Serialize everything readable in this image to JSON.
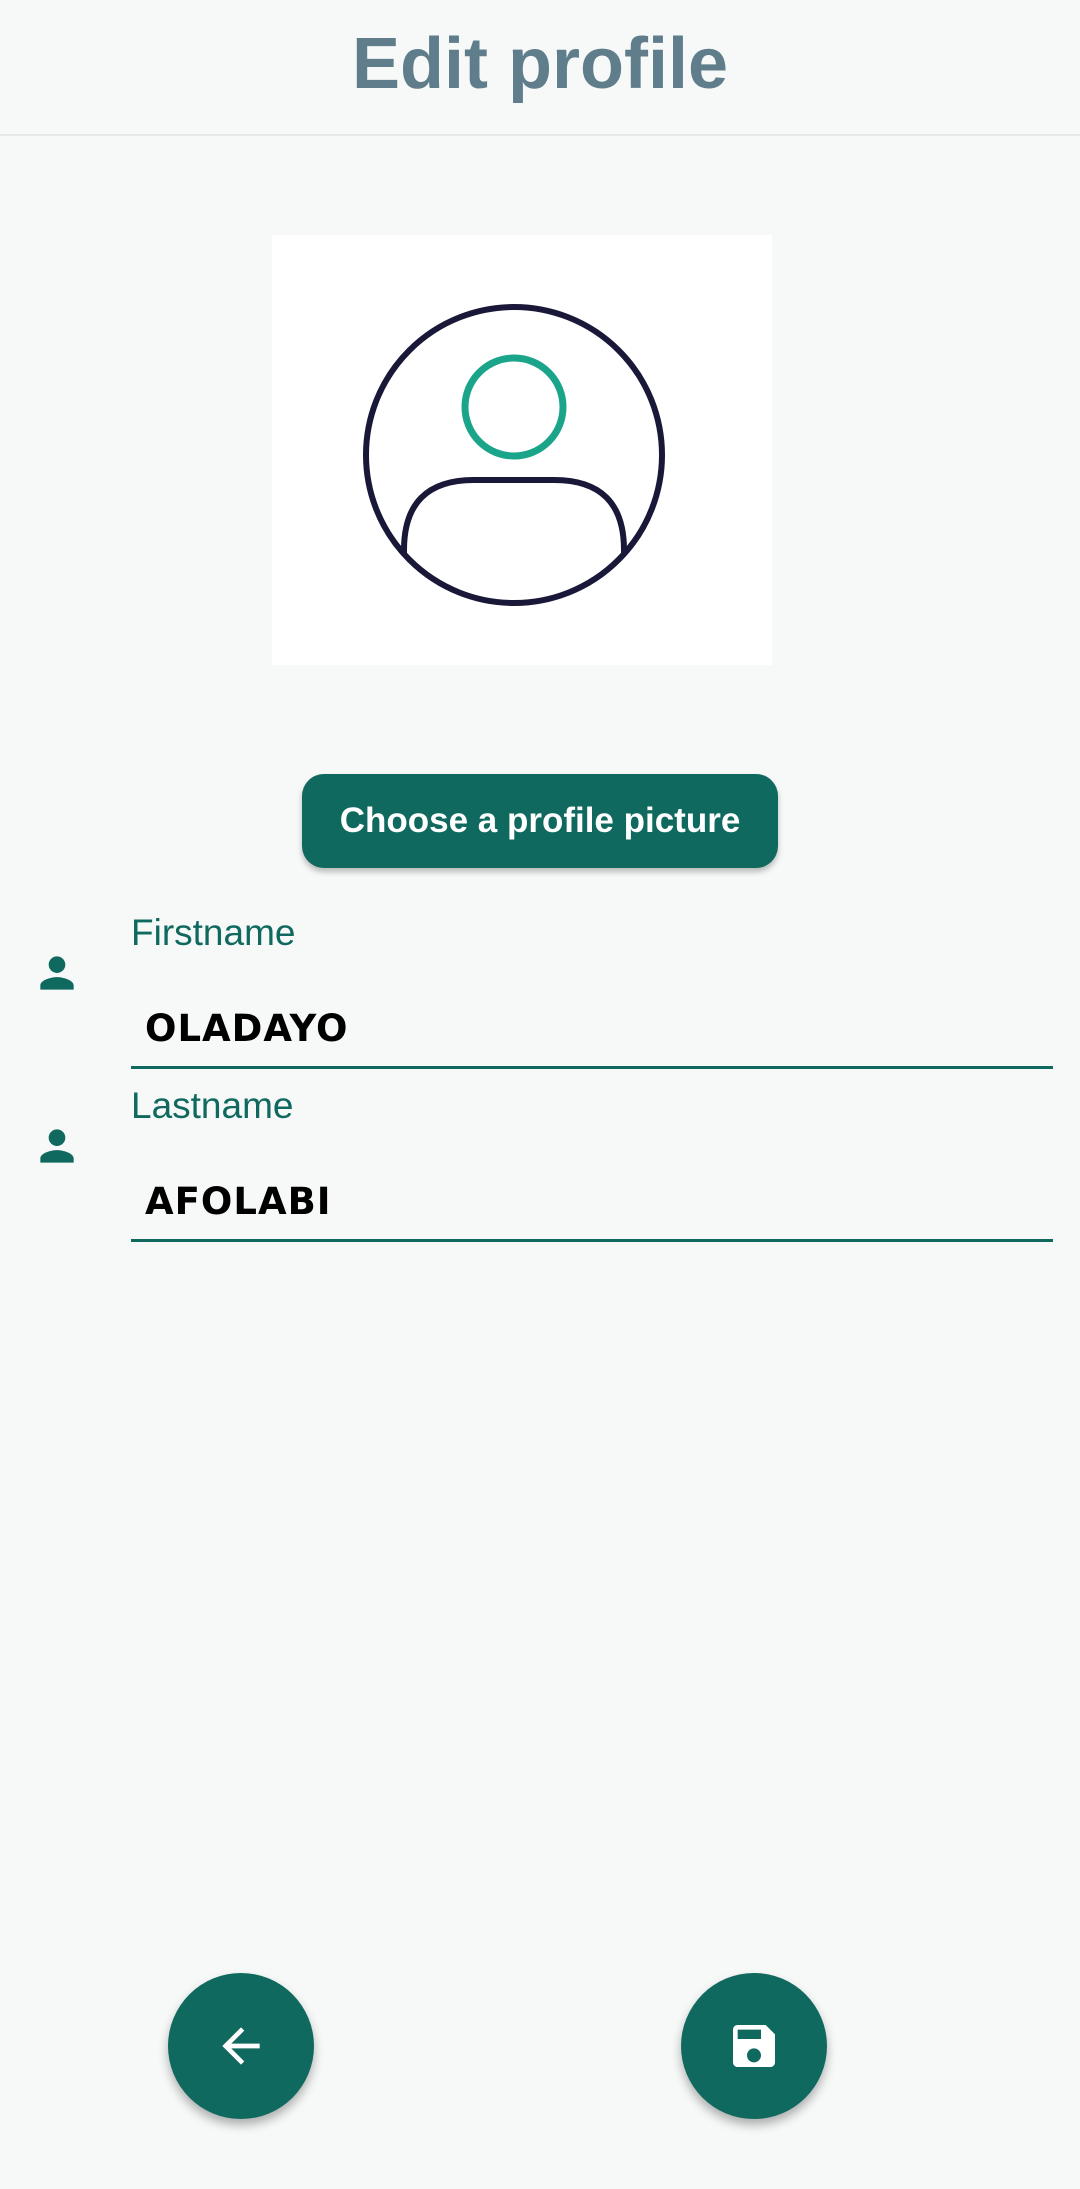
{
  "app_bar": {
    "title": "Edit profile"
  },
  "avatar": {
    "icon": "default-avatar-icon",
    "head_color": "#1aa58a",
    "outline_color": "#1a1838"
  },
  "choose_button": {
    "label": "Choose a profile picture"
  },
  "form": {
    "firstname": {
      "icon": "person-icon",
      "label": "Firstname",
      "value": "OLADAYO"
    },
    "lastname": {
      "icon": "person-icon",
      "label": "Lastname",
      "value": "AFOLABI"
    }
  },
  "actions": {
    "back_icon": "arrow-back-icon",
    "save_icon": "save-icon"
  },
  "colors": {
    "primary": "#10695e",
    "title": "#5f7d8b",
    "background": "#f7f9f9"
  }
}
